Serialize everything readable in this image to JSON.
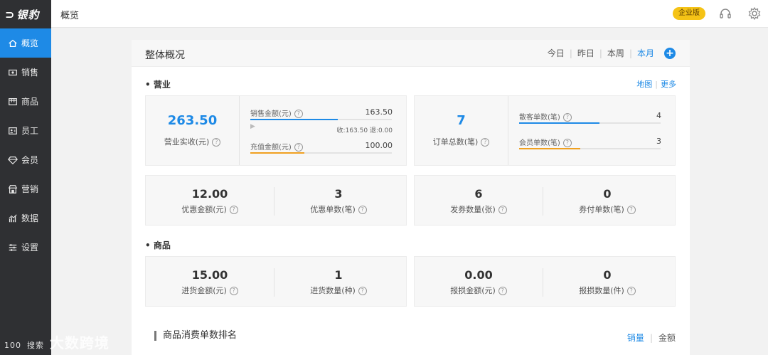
{
  "app": {
    "logo_mark": "⊃",
    "logo_text": "银豹",
    "edition_badge": "企业版"
  },
  "sidebar": {
    "items": [
      {
        "label": "概览",
        "icon": "home-icon",
        "active": true
      },
      {
        "label": "销售",
        "icon": "cash-icon"
      },
      {
        "label": "商品",
        "icon": "box-icon"
      },
      {
        "label": "员工",
        "icon": "id-card-icon"
      },
      {
        "label": "会员",
        "icon": "diamond-icon"
      },
      {
        "label": "营销",
        "icon": "shop-icon"
      },
      {
        "label": "数据",
        "icon": "chart-icon"
      },
      {
        "label": "设置",
        "icon": "sliders-icon"
      }
    ]
  },
  "topbar": {
    "breadcrumb": "概览"
  },
  "overview": {
    "title": "整体概况",
    "ranges": [
      "今日",
      "昨日",
      "本周",
      "本月"
    ],
    "active_range": "本月",
    "add_symbol": "+"
  },
  "business": {
    "title": "• 营业",
    "links": [
      "地图",
      "更多"
    ],
    "revenue": {
      "value": "263.50",
      "caption": "营业实收(元)",
      "sales_label": "销售金额(元)",
      "sales_value": "163.50",
      "sales_fill": 0.62,
      "sales_sub": "收:163.50 退:0.00",
      "recharge_label": "充值金额(元)",
      "recharge_value": "100.00",
      "recharge_fill": 0.38
    },
    "orders": {
      "value": "7",
      "caption": "订单总数(笔)",
      "walkin_label": "散客单数(笔)",
      "walkin_value": "4",
      "walkin_fill": 0.57,
      "member_label": "会员单数(笔)",
      "member_value": "3",
      "member_fill": 0.43
    },
    "stats": [
      {
        "value": "12.00",
        "caption": "优惠金额(元)"
      },
      {
        "value": "3",
        "caption": "优惠单数(笔)"
      },
      {
        "value": "6",
        "caption": "发券数量(张)"
      },
      {
        "value": "0",
        "caption": "券付单数(笔)"
      }
    ]
  },
  "goods": {
    "title": "• 商品",
    "stats": [
      {
        "value": "15.00",
        "caption": "进货金额(元)"
      },
      {
        "value": "1",
        "caption": "进货数量(种)"
      },
      {
        "value": "0.00",
        "caption": "报损金额(元)"
      },
      {
        "value": "0",
        "caption": "报损数量(件)"
      }
    ]
  },
  "ranking": {
    "title": "商品消费单数排名",
    "tabs": [
      "销量",
      "金额"
    ],
    "active_tab": "销量"
  },
  "colors": {
    "accent": "#1e8ae6",
    "orange": "#f0a020",
    "badge": "#f5c316",
    "sidebar": "#2f3033"
  },
  "watermark": {
    "prefix": "100",
    "text": "大数跨境",
    "hidden_label": "搜索"
  }
}
